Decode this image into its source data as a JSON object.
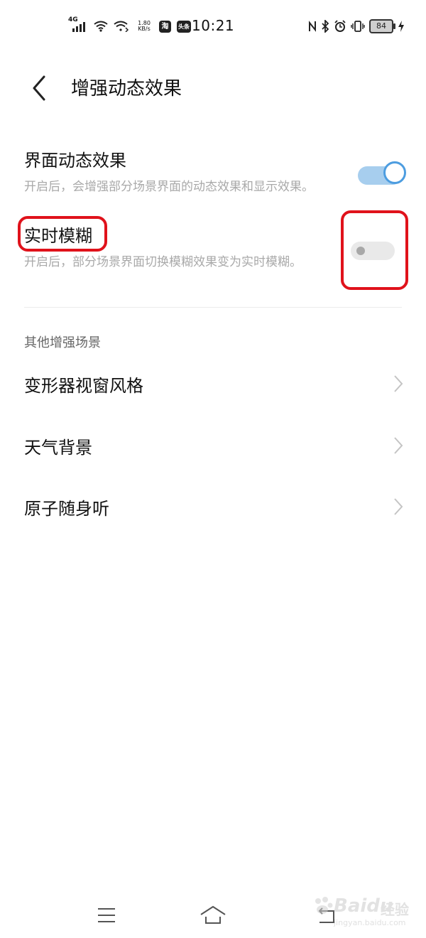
{
  "status_bar": {
    "network": "4G",
    "speed_value": "1.80",
    "speed_unit": "KB/s",
    "app_badge_1": "淘",
    "app_badge_2": "头条",
    "time": "10:21",
    "battery_level": "84",
    "icons": [
      "signal-icon",
      "wifi-icon",
      "wifi-hotspot-icon",
      "nfc-icon",
      "bluetooth-icon",
      "alarm-icon",
      "vibrate-icon",
      "battery-icon",
      "charging-icon"
    ]
  },
  "header": {
    "title": "增强动态效果",
    "back_icon": "back-arrow-icon"
  },
  "settings": [
    {
      "title": "界面动态效果",
      "description": "开启后，会增强部分场景界面的动态效果和显示效果。",
      "enabled": true
    },
    {
      "title": "实时模糊",
      "description": "开启后，部分场景界面切换模糊效果变为实时模糊。",
      "enabled": false
    }
  ],
  "section": {
    "header": "其他增强场景",
    "items": [
      {
        "label": "变形器视窗风格"
      },
      {
        "label": "天气背景"
      },
      {
        "label": "原子随身听"
      }
    ]
  },
  "navigation": {
    "icons": [
      "menu-icon",
      "home-icon",
      "back-nav-icon"
    ]
  },
  "watermark": {
    "brand": "Baidu",
    "cn": "经验",
    "url": "jingyan.baidu.com"
  },
  "colors": {
    "accent": "#4d9de0",
    "toggle_on_track": "#a7ceee",
    "highlight": "#e0121b"
  }
}
